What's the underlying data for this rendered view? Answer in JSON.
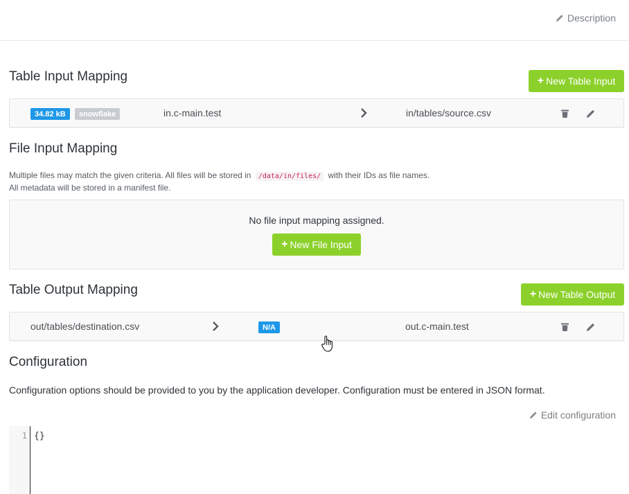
{
  "header": {
    "description_label": "Description"
  },
  "table_input": {
    "title": "Table Input Mapping",
    "new_button_label": "New Table Input",
    "rows": [
      {
        "size_badge": "34.82 kB",
        "backend_badge": "snowflake",
        "source": "in.c-main.test",
        "destination": "in/tables/source.csv"
      }
    ]
  },
  "file_input": {
    "title": "File Input Mapping",
    "note_part1": "Multiple files may match the given criteria. All files will be stored in",
    "note_path": "/data/in/files/",
    "note_part2": "with their IDs as file names.",
    "note_line2": "All metadata will be stored in a manifest file.",
    "empty_text": "No file input mapping assigned.",
    "new_button_label": "New File Input"
  },
  "table_output": {
    "title": "Table Output Mapping",
    "new_button_label": "New Table Output",
    "rows": [
      {
        "source": "out/tables/destination.csv",
        "size_badge": "N/A",
        "destination": "out.c-main.test"
      }
    ]
  },
  "configuration": {
    "title": "Configuration",
    "help_text": "Configuration options should be provided to you by the application developer. Configuration must be entered in JSON format.",
    "edit_label": "Edit configuration",
    "editor": {
      "line_number": "1",
      "code": "{}"
    }
  },
  "colors": {
    "accent_green": "#8cd12b",
    "badge_blue": "#1e98e8",
    "badge_gray": "#c8ccd1"
  },
  "icons": [
    "pencil-icon",
    "plus-icon",
    "chevron-right-icon",
    "trash-icon",
    "hand-cursor-icon"
  ]
}
